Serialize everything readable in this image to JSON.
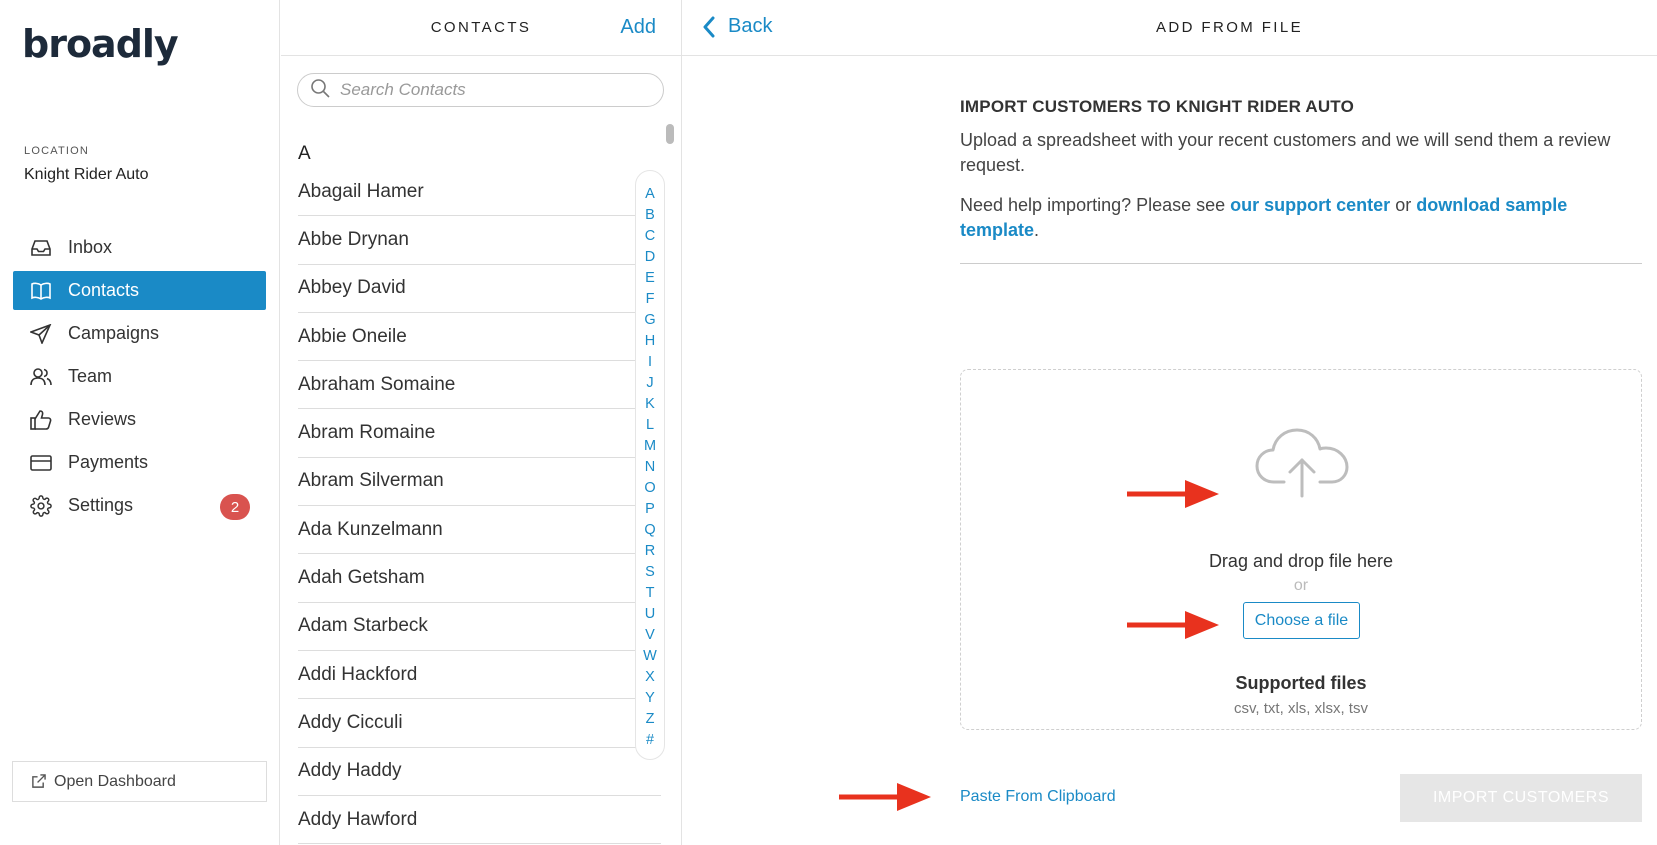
{
  "brand": {
    "logo_text": "broadly"
  },
  "location": {
    "label": "LOCATION",
    "name": "Knight Rider Auto"
  },
  "nav": [
    {
      "label": "Inbox",
      "icon": "inbox-icon",
      "active": false
    },
    {
      "label": "Contacts",
      "icon": "book-icon",
      "active": true
    },
    {
      "label": "Campaigns",
      "icon": "paper-plane-icon",
      "active": false
    },
    {
      "label": "Team",
      "icon": "users-icon",
      "active": false
    },
    {
      "label": "Reviews",
      "icon": "thumbs-up-icon",
      "active": false
    },
    {
      "label": "Payments",
      "icon": "credit-card-icon",
      "active": false
    },
    {
      "label": "Settings",
      "icon": "gear-icon",
      "active": false,
      "badge": "2"
    }
  ],
  "open_dashboard": {
    "label": "Open Dashboard"
  },
  "contacts": {
    "title": "CONTACTS",
    "add_label": "Add",
    "search_placeholder": "Search Contacts",
    "section_letter": "A",
    "items": [
      "Abagail Hamer",
      "Abbe Drynan",
      "Abbey David",
      "Abbie Oneile",
      "Abraham Somaine",
      "Abram Romaine",
      "Abram Silverman",
      "Ada Kunzelmann",
      "Adah Getsham",
      "Adam Starbeck",
      "Addi Hackford",
      "Addy Cicculi",
      "Addy Haddy",
      "Addy Hawford"
    ],
    "alphabet": [
      "A",
      "B",
      "C",
      "D",
      "E",
      "F",
      "G",
      "H",
      "I",
      "J",
      "K",
      "L",
      "M",
      "N",
      "O",
      "P",
      "Q",
      "R",
      "S",
      "T",
      "U",
      "V",
      "W",
      "X",
      "Y",
      "Z",
      "#"
    ]
  },
  "main": {
    "back_label": "Back",
    "title": "ADD FROM FILE",
    "import_title": "IMPORT CUSTOMERS TO KNIGHT RIDER AUTO",
    "description": "Upload a spreadsheet with your recent customers and we will send them a review request.",
    "help_prefix": "Need help importing? Please see ",
    "help_link1": "our support center",
    "help_middle": " or ",
    "help_link2": "download sample template",
    "help_suffix": ".",
    "drag_text": "Drag and drop file here",
    "or_text": "or",
    "choose_label": "Choose a file",
    "supported_title": "Supported files",
    "supported_list": "csv, txt, xls, xlsx, tsv",
    "paste_label": "Paste From Clipboard",
    "import_label": "IMPORT CUSTOMERS"
  },
  "colors": {
    "accent": "#1a8ac6",
    "badge": "#d9534f",
    "arrow": "#e8321e"
  }
}
